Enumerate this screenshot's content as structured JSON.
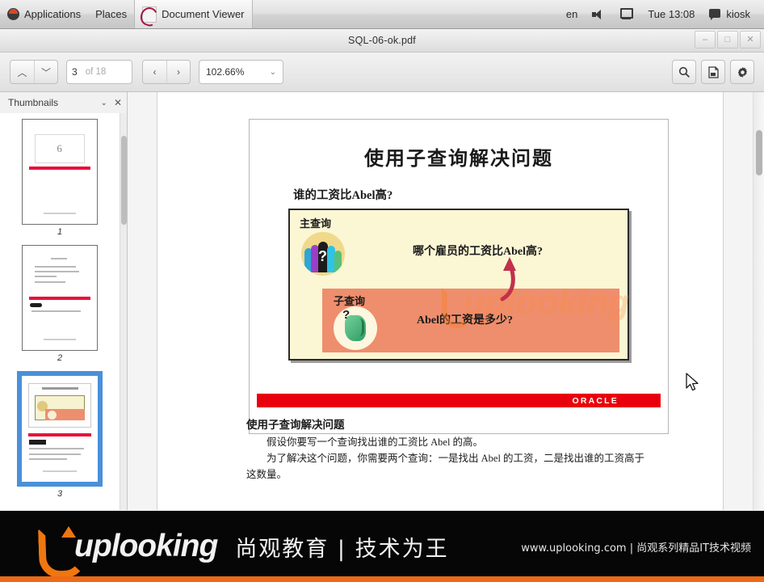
{
  "desktop": {
    "panel": {
      "applications": "Applications",
      "places": "Places",
      "active_app": "Document Viewer",
      "keyboard_layout": "en",
      "clock": "Tue 13:08",
      "user": "kiosk",
      "icons": {
        "ubuntu": "ubuntu-logo-icon",
        "app": "document-viewer-icon",
        "volume": "volume-icon",
        "network": "network-icon",
        "user": "user-session-icon"
      }
    }
  },
  "window": {
    "title": "SQL-06-ok.pdf",
    "buttons": {
      "minimize": "–",
      "maximize": "□",
      "close": "✕"
    }
  },
  "toolbar": {
    "prev_page_arrow": "︿",
    "next_page_arrow": "﹀",
    "current_page": "3",
    "page_total": "of 18",
    "history_back": "‹",
    "history_forward": "›",
    "zoom_level": "102.66%",
    "zoom_chevron": "⌄",
    "search_icon": "search-icon",
    "annotation_icon": "add-annotation-icon",
    "settings_icon": "gear-icon"
  },
  "sidebar": {
    "title": "Thumbnails",
    "chevron": "⌄",
    "close": "✕",
    "thumbnails": [
      {
        "label": "1",
        "selected": false
      },
      {
        "label": "2",
        "selected": false
      },
      {
        "label": "3",
        "selected": true
      }
    ]
  },
  "pdf": {
    "slide": {
      "title": "使用子查询解决问题",
      "subtitle": "谁的工资比Abel高?",
      "watermark": "uplooking",
      "main_query_label": "主查询",
      "main_query_text": "哪个雇员的工资比Abel高?",
      "sub_query_label": "子查询",
      "sub_query_text": "Abel的工资是多少?",
      "people_icon": "people-group-icon",
      "money_icon": "money-stack-icon",
      "question_mark": "?",
      "footer_brand": "ORACLE"
    },
    "body": {
      "heading": "使用子查询解决问题",
      "paragraph1": "假设你要写一个查询找出谁的工资比 Abel 的高。",
      "paragraph2": "为了解决这个问题，你需要两个查询：一是找出 Abel 的工资，二是找出谁的工资高于",
      "paragraph3": "这数量。"
    }
  },
  "banner": {
    "brand": "uplooking",
    "brand_cn": "尚观教育 | 技术为王",
    "site_line": "www.uplooking.com | 尚观系列精品IT技术视频"
  },
  "colors": {
    "oracle_red": "#e8000d",
    "brand_orange": "#f0760f",
    "selection_blue": "#4a90d9",
    "slide_yellow": "#fbf6d4",
    "slide_orange": "#ee8e6c"
  }
}
